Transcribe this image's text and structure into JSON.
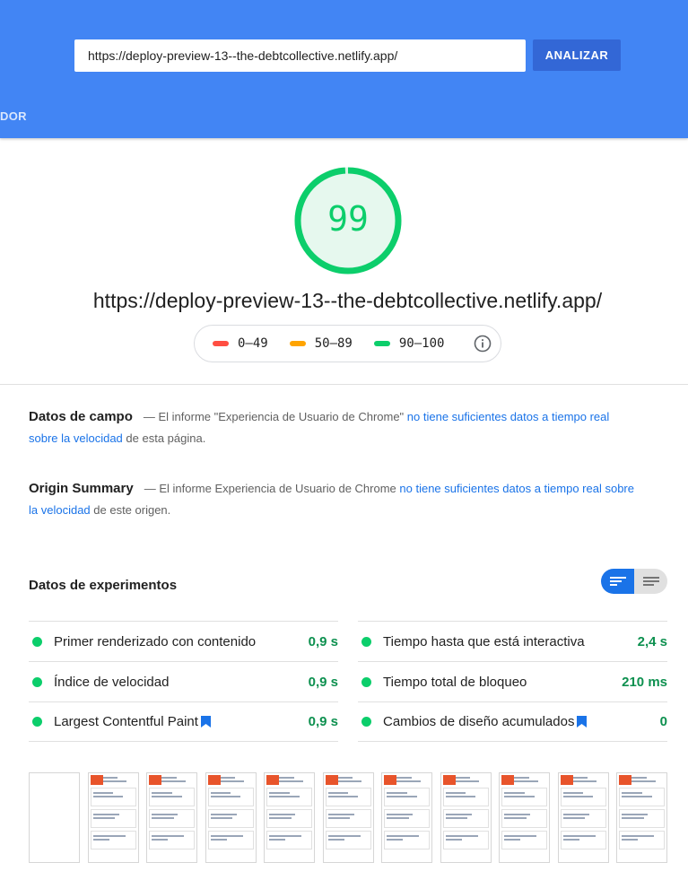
{
  "header": {
    "url_value": "https://deploy-preview-13--the-debtcollective.netlify.app/",
    "analyze_label": "ANALIZAR",
    "partial_tab": "DOR",
    "bg_color": "#4285f4"
  },
  "score": {
    "value": "99",
    "fraction": 0.99,
    "color": "#0cce6b",
    "url": "https://deploy-preview-13--the-debtcollective.netlify.app/"
  },
  "legend": {
    "items": [
      {
        "label": "0–49",
        "color": "#ff4e42"
      },
      {
        "label": "50–89",
        "color": "#ffa400"
      },
      {
        "label": "90–100",
        "color": "#0cce6b"
      }
    ],
    "info_icon": "info-icon"
  },
  "field_data": {
    "heading": "Datos de campo",
    "text_before": "— El informe \"Experiencia de Usuario de Chrome\" ",
    "link": "no tiene suficientes datos a tiempo real sobre la velocidad",
    "text_after": " de esta página."
  },
  "origin_summary": {
    "heading": "Origin Summary",
    "text_before": "— El informe Experiencia de Usuario de Chrome ",
    "link": "no tiene suficientes datos a tiempo real sobre la velocidad",
    "text_after": " de este origen."
  },
  "lab": {
    "title": "Datos de experimentos",
    "left": [
      {
        "label": "Primer renderizado con contenido",
        "value": "0,9 s",
        "bookmark": false
      },
      {
        "label": "Índice de velocidad",
        "value": "0,9 s",
        "bookmark": false
      },
      {
        "label": "Largest Contentful Paint",
        "value": "0,9 s",
        "bookmark": true
      }
    ],
    "right": [
      {
        "label": "Tiempo hasta que está interactiva",
        "value": "2,4 s",
        "bookmark": false
      },
      {
        "label": "Tiempo total de bloqueo",
        "value": "210 ms",
        "bookmark": false
      },
      {
        "label": "Cambios de diseño acumulados",
        "value": "0",
        "bookmark": true
      }
    ]
  }
}
